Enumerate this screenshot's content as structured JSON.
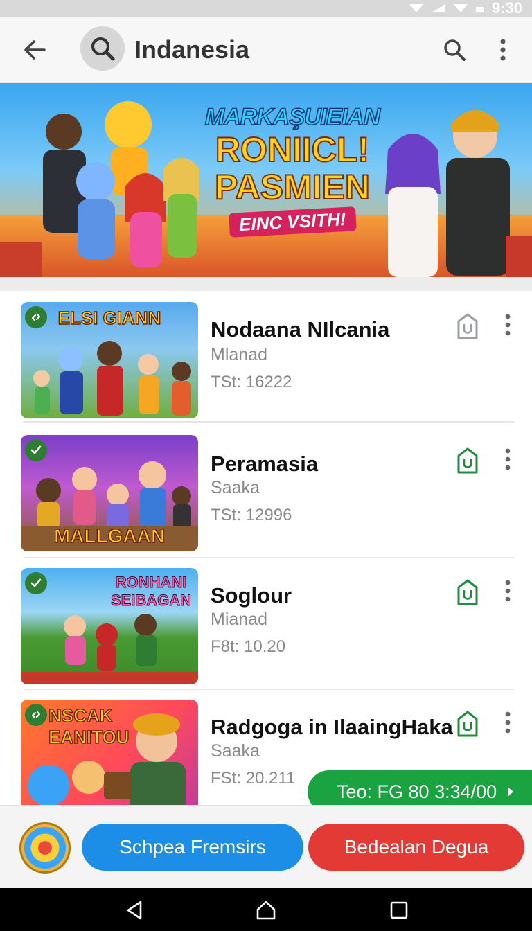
{
  "status_bar": {
    "time": "9:30"
  },
  "app_bar": {
    "title": "Indanesia",
    "icons": [
      "back-arrow-icon",
      "search-icon",
      "more-vert-icon"
    ]
  },
  "banner": {
    "line1": "MARKAŞUIEIAN",
    "line2": "RONIICL!",
    "line3": "PASMIEN",
    "line4": "EINC VSITH!"
  },
  "list": [
    {
      "title": "Nodaana NIlcania",
      "subtitle": "Mlanad",
      "meta": "TSt: 16222",
      "thumb_text": "ELSI GIANN",
      "installed": false,
      "accent": "#9aa0a6"
    },
    {
      "title": "Peramasia",
      "subtitle": "Saaka",
      "meta": "TSt: 12996",
      "thumb_text": "MALLGAAN",
      "installed": true,
      "accent": "#1e8e3e"
    },
    {
      "title": "Soglour",
      "subtitle": "Mianad",
      "meta": "F8t: 10.20",
      "thumb_text": "RONHANI SEIBAGAN",
      "installed": true,
      "accent": "#1e8e3e"
    },
    {
      "title": "Radgoga in IlaaingHaka",
      "subtitle": "Saaka",
      "meta": "FSt: 20.211",
      "thumb_text": "NSCAK EANITOU",
      "installed": true,
      "accent": "#1e8e3e"
    }
  ],
  "promo_pill": {
    "label": "Teo: FG 80 3:34/00"
  },
  "action_bar": {
    "primary_label": "Schpea Fremsirs",
    "secondary_label": "Bedealan Degua"
  },
  "colors": {
    "green": "#1aa340",
    "blue": "#1c8ee8",
    "red": "#e33a36"
  }
}
